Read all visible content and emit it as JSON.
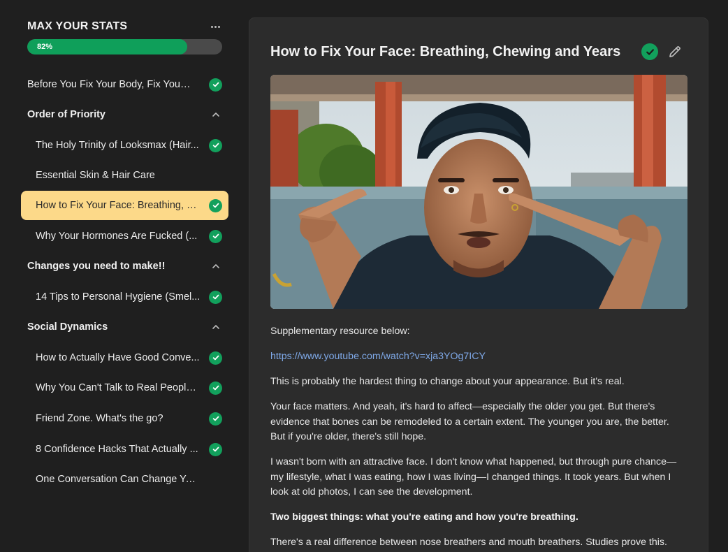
{
  "course": {
    "title": "MAX YOUR STATS",
    "progress_label": "82%",
    "progress_value": 0.82
  },
  "colors": {
    "accent_green": "#12a05c",
    "active_item_bg": "#fcd989",
    "link": "#7fa9e8"
  },
  "sidebar": {
    "items": [
      {
        "type": "item",
        "label": "Before You Fix Your Body, Fix Your ...",
        "completed": true
      },
      {
        "type": "section",
        "label": "Order of Priority"
      },
      {
        "type": "item",
        "label": "The Holy Trinity of Looksmax (Hair...",
        "completed": true
      },
      {
        "type": "item",
        "label": "Essential Skin & Hair Care",
        "completed": false
      },
      {
        "type": "item",
        "label": "How to Fix Your Face: Breathing, C...",
        "completed": true,
        "active": true
      },
      {
        "type": "item",
        "label": "Why Your Hormones Are Fucked (...",
        "completed": true
      },
      {
        "type": "section",
        "label": "Changes you need to make!!"
      },
      {
        "type": "item",
        "label": "14 Tips to Personal Hygiene (Smel...",
        "completed": true
      },
      {
        "type": "section",
        "label": "Social Dynamics"
      },
      {
        "type": "item",
        "label": "How to Actually Have Good Conve...",
        "completed": true
      },
      {
        "type": "item",
        "label": "Why You Can't Talk to Real People ...",
        "completed": true
      },
      {
        "type": "item",
        "label": "Friend Zone. What's the go?",
        "completed": true
      },
      {
        "type": "item",
        "label": "8 Confidence Hacks That Actually ...",
        "completed": true
      },
      {
        "type": "item",
        "label": "One Conversation Can Change Your Life",
        "completed": false
      }
    ]
  },
  "lesson": {
    "title": "How to Fix Your Face: Breathing, Chewing and Years",
    "completed": true,
    "paragraphs": {
      "p1": "Supplementary resource below:",
      "link": "https://www.youtube.com/watch?v=xja3YOg7ICY",
      "p2": "This is probably the hardest thing to change about your appearance. But it's real.",
      "p3": "Your face matters. And yeah, it's hard to affect—especially the older you get. But there's evidence that bones can be remodeled to a certain extent. The younger you are, the better. But if you're older, there's still hope.",
      "p4": "I wasn't born with an attractive face. I don't know what happened, but through pure chance—my lifestyle, what I was eating, how I was living—I changed things. It took years. But when I look at old photos, I can see the development.",
      "p5": "Two biggest things: what you're eating and how you're breathing.",
      "p6": "There's a real difference between nose breathers and mouth breathers. Studies prove this."
    }
  }
}
